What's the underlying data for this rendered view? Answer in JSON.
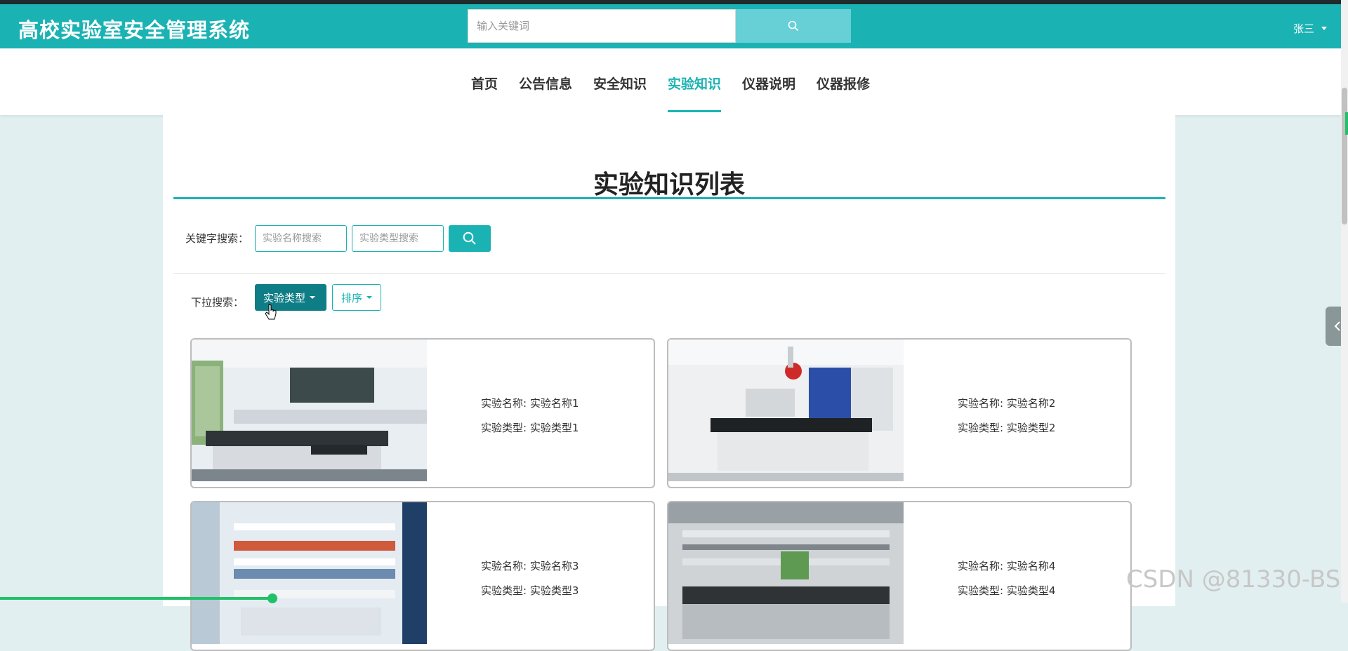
{
  "app": {
    "title": "高校实验室安全管理系统",
    "accent": "#1bb2b3",
    "dark_accent": "#0f7d86"
  },
  "header": {
    "search_placeholder": "输入关键词",
    "search_icon": "search-icon",
    "user_name": "张三"
  },
  "nav": {
    "items": [
      "首页",
      "公告信息",
      "安全知识",
      "实验知识",
      "仪器说明",
      "仪器报修"
    ],
    "active": "实验知识"
  },
  "page": {
    "title": "实验知识列表",
    "keyword_label": "关键字搜索：",
    "name_placeholder": "实验名称搜索",
    "type_placeholder": "实验类型搜索",
    "dropdown_label": "下拉搜索：",
    "type_button": "实验类型",
    "sort_button": "排序"
  },
  "cards": [
    {
      "name_label": "实验名称:",
      "name": "实验名称1",
      "type_label": "实验类型:",
      "type": "实验类型1"
    },
    {
      "name_label": "实验名称:",
      "name": "实验名称2",
      "type_label": "实验类型:",
      "type": "实验类型2"
    },
    {
      "name_label": "实验名称:",
      "name": "实验名称3",
      "type_label": "实验类型:",
      "type": "实验类型3"
    },
    {
      "name_label": "实验名称:",
      "name": "实验名称4",
      "type_label": "实验类型:",
      "type": "实验类型4"
    }
  ],
  "watermark": "CSDN @81330-BS"
}
